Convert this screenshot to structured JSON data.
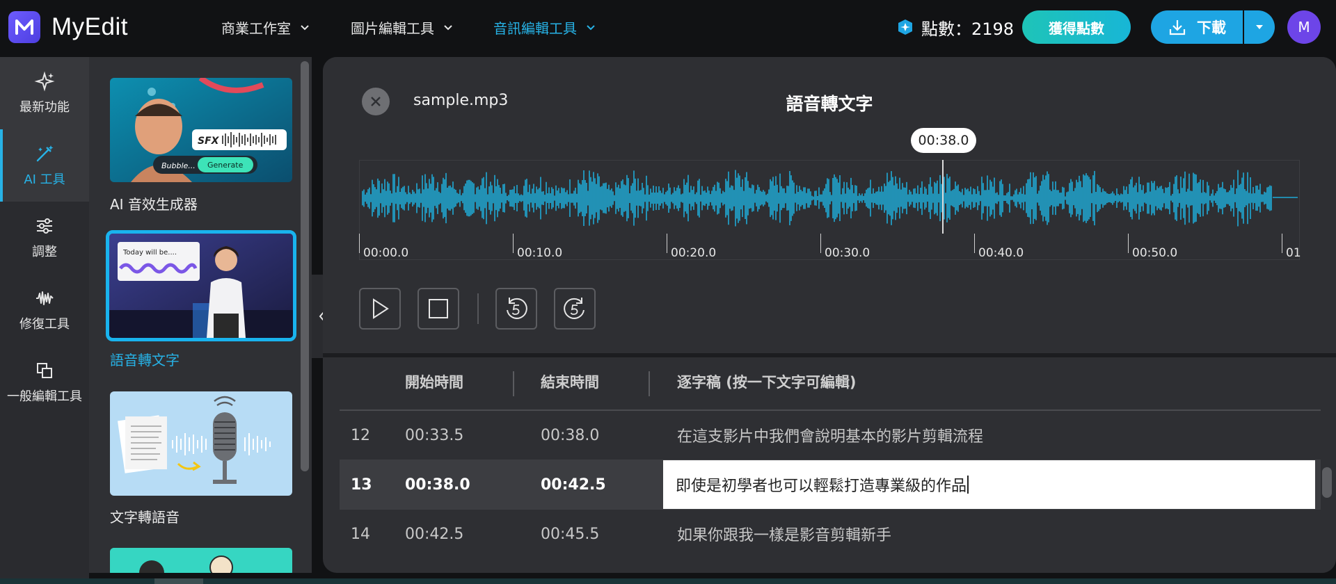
{
  "app": {
    "brand": "MyEdit",
    "accent": "#27b2e6"
  },
  "nav": [
    {
      "label": "商業工作室",
      "active": false
    },
    {
      "label": "圖片編輯工具",
      "active": false
    },
    {
      "label": "音訊編輯工具",
      "active": true
    }
  ],
  "header": {
    "points_label": "點數：2198",
    "earn_button": "獲得點數",
    "download_button": "下載",
    "avatar_initial": "M"
  },
  "rail": [
    {
      "label": "最新功能",
      "icon": "sparkle-icon"
    },
    {
      "label": "AI 工具",
      "icon": "magic-wand-icon",
      "active": true
    },
    {
      "label": "調整",
      "icon": "sliders-icon"
    },
    {
      "label": "修復工具",
      "icon": "waveform-repair-icon"
    },
    {
      "label": "一般編輯工具",
      "icon": "layers-icon"
    }
  ],
  "tools": [
    {
      "label": "AI 音效生成器",
      "thumb_text_1": "SFX",
      "thumb_text_2": "Bubble...",
      "thumb_button": "Generate"
    },
    {
      "label": "語音轉文字",
      "thumb_text": "Today will be....",
      "selected": true
    },
    {
      "label": "文字轉語音"
    }
  ],
  "editor": {
    "file_name": "sample.mp3",
    "title": "語音轉文字",
    "playhead_time": "00:38.0",
    "timeline_ticks": [
      "00:00.0",
      "00:10.0",
      "00:20.0",
      "00:30.0",
      "00:40.0",
      "00:50.0",
      "01"
    ]
  },
  "transcript": {
    "columns": [
      "開始時間",
      "結束時間",
      "逐字稿 (按一下文字可編輯)"
    ],
    "rows": [
      {
        "index": "12",
        "start": "00:33.5",
        "end": "00:38.0",
        "text": "在這支影片中我們會說明基本的影片剪輯流程"
      },
      {
        "index": "13",
        "start": "00:38.0",
        "end": "00:42.5",
        "text": "即使是初學者也可以輕鬆打造專業級的作品",
        "current": true
      },
      {
        "index": "14",
        "start": "00:42.5",
        "end": "00:45.5",
        "text": "如果你跟我一樣是影音剪輯新手"
      }
    ]
  }
}
